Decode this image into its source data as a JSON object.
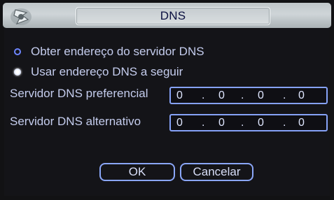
{
  "dialog": {
    "title": "DNS"
  },
  "options": [
    {
      "label": "Obter endereço do servidor DNS",
      "selected": false
    },
    {
      "label": "Usar endereço DNS a seguir",
      "selected": true
    }
  ],
  "fields": [
    {
      "label": "Servidor DNS preferencial",
      "octets": [
        "0",
        "0",
        "0",
        "0"
      ]
    },
    {
      "label": "Servidor DNS alternativo",
      "octets": [
        "0",
        "0",
        "0",
        "0"
      ]
    }
  ],
  "buttons": {
    "ok": "OK",
    "cancel": "Cancelar"
  },
  "colors": {
    "accent": "#86a2f7",
    "text": "#c4cced",
    "background": "#121214"
  },
  "icons": {
    "logo": "brand-logo-icon"
  }
}
